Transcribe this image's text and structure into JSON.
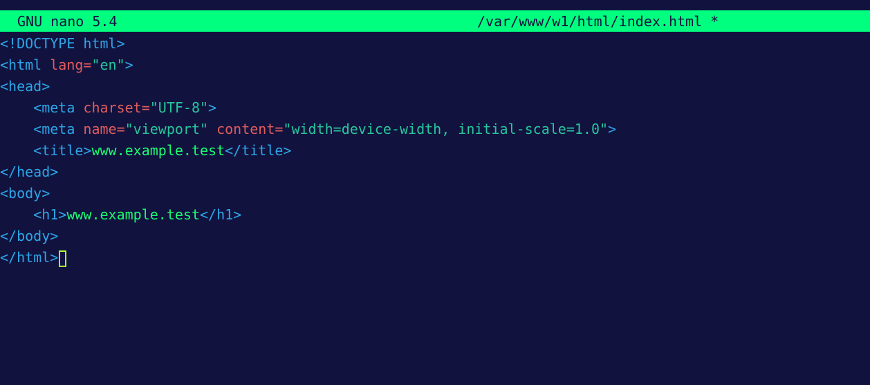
{
  "titlebar": {
    "app": "GNU nano 5.4",
    "file": "/var/www/w1/html/index.html",
    "modified": "*"
  },
  "colors": {
    "background": "#12123f",
    "titlebar": "#00ff7f",
    "tag": "#2ca6e6",
    "attribute": "#e05c5c",
    "string": "#27c79b",
    "text": "#19ff70",
    "cursor": "#aaff33"
  },
  "lines": [
    [
      {
        "t": "tag",
        "v": "<!DOCTYPE html>"
      }
    ],
    [
      {
        "t": "tag",
        "v": "<html "
      },
      {
        "t": "attr",
        "v": "lang="
      },
      {
        "t": "str",
        "v": "\"en\""
      },
      {
        "t": "tag",
        "v": ">"
      }
    ],
    [
      {
        "t": "tag",
        "v": "<head>"
      }
    ],
    [
      {
        "t": "plain",
        "v": "    "
      },
      {
        "t": "tag",
        "v": "<meta "
      },
      {
        "t": "attr",
        "v": "charset="
      },
      {
        "t": "str",
        "v": "\"UTF-8\""
      },
      {
        "t": "tag",
        "v": ">"
      }
    ],
    [
      {
        "t": "plain",
        "v": "    "
      },
      {
        "t": "tag",
        "v": "<meta "
      },
      {
        "t": "attr",
        "v": "name="
      },
      {
        "t": "str",
        "v": "\"viewport\" "
      },
      {
        "t": "attr",
        "v": "content="
      },
      {
        "t": "str",
        "v": "\"width=device-width, initial-scale=1.0\""
      },
      {
        "t": "tag",
        "v": ">"
      }
    ],
    [
      {
        "t": "plain",
        "v": "    "
      },
      {
        "t": "tag",
        "v": "<title>"
      },
      {
        "t": "txt",
        "v": "www.example.test"
      },
      {
        "t": "tag",
        "v": "</title>"
      }
    ],
    [
      {
        "t": "tag",
        "v": "</head>"
      }
    ],
    [
      {
        "t": "tag",
        "v": "<body>"
      }
    ],
    [
      {
        "t": "plain",
        "v": "    "
      },
      {
        "t": "tag",
        "v": "<h1>"
      },
      {
        "t": "txt",
        "v": "www.example.test"
      },
      {
        "t": "tag",
        "v": "</h1>"
      }
    ],
    [
      {
        "t": "tag",
        "v": "</body>"
      }
    ],
    [
      {
        "t": "tag",
        "v": "</html>"
      },
      {
        "t": "cursor",
        "v": ""
      }
    ]
  ]
}
